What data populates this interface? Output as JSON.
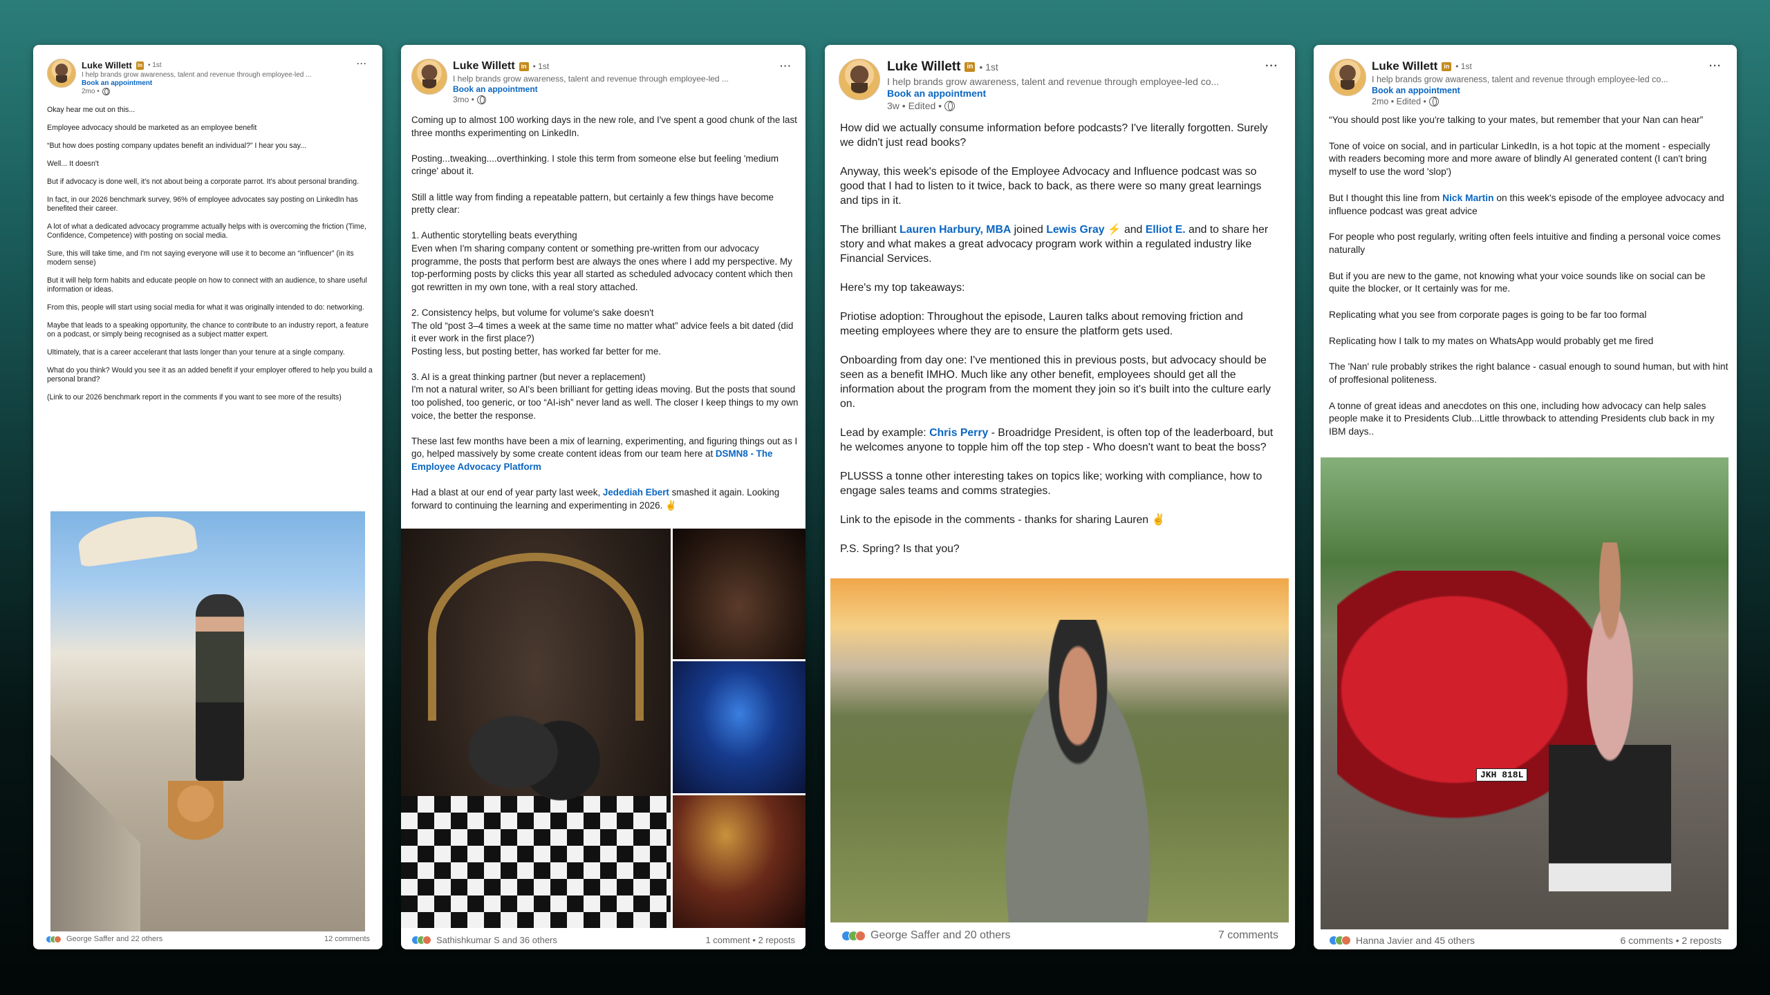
{
  "posts": [
    {
      "author": "Luke Willett",
      "badge": "in",
      "degree": "• 1st",
      "headline": "I help brands grow awareness, talent and revenue through employee-led ...",
      "cta": "Book an appointment",
      "meta": "2mo •",
      "body": [
        [
          {
            "t": "Okay hear me out on this..."
          }
        ],
        [
          {
            "t": "Employee advocacy should be marketed as an employee benefit"
          }
        ],
        [
          {
            "t": "“But how does posting company updates benefit an individual?” I hear you say..."
          }
        ],
        [
          {
            "t": "Well... It doesn't"
          }
        ],
        [
          {
            "t": "But if advocacy is done well, it's not about being a corporate parrot. It's about personal branding."
          }
        ],
        [
          {
            "t": "In fact, in our 2026 benchmark survey, 96% of employee advocates say posting on LinkedIn has benefited their career."
          }
        ],
        [
          {
            "t": "A lot of what a dedicated advocacy programme actually helps with is overcoming the friction (Time, Confidence, Competence) with posting on social media."
          }
        ],
        [
          {
            "t": "Sure, this will take time, and I'm not saying everyone will use it to become an “influencer” (in its modern sense)"
          }
        ],
        [
          {
            "t": "But it will help form habits and educate people on how to connect with an audience, to share useful information or ideas."
          }
        ],
        [
          {
            "t": "From this, people will start using social media for what it was originally intended to do: networking."
          }
        ],
        [
          {
            "t": "Maybe that leads to a speaking opportunity, the chance to contribute to an industry report, a feature on a podcast, or simply being recognised as a subject matter expert."
          }
        ],
        [
          {
            "t": "Ultimately, that is a career accelerant that lasts longer than your tenure at a single company."
          }
        ],
        [
          {
            "t": "What do you think? Would you see it as an added benefit if your employer offered to help you build a personal brand?"
          }
        ],
        [
          {
            "t": "(Link to our 2026 benchmark report in the comments if you want to see more of the results)"
          }
        ]
      ],
      "reactions": "George Saffer and 22 others",
      "stats": "12 comments"
    },
    {
      "author": "Luke Willett",
      "badge": "in",
      "degree": "• 1st",
      "headline": "I help brands grow awareness, talent and revenue through employee-led ...",
      "cta": "Book an appointment",
      "meta": "3mo •",
      "body": [
        [
          {
            "t": "Coming up to almost 100 working days in the new role, and I've spent a good chunk of the last three months experimenting on LinkedIn."
          }
        ],
        [
          {
            "t": "Posting...tweaking....overthinking. I stole this term from someone else but feeling 'medium cringe' about it."
          }
        ],
        [
          {
            "t": "Still a little way from finding a repeatable pattern, but certainly a few things have become pretty clear:"
          }
        ],
        [
          {
            "t": "1. Authentic storytelling beats everything\nEven when I'm sharing company content or something pre-written from our advocacy programme, the posts that perform best are always the ones where I add my perspective. My top-performing posts by clicks this year all started as scheduled advocacy content which then got rewritten in my own tone, with a real story attached."
          }
        ],
        [
          {
            "t": "2. Consistency helps, but volume for volume's sake doesn't\nThe old “post 3–4 times a week at the same time no matter what” advice feels a bit dated (did it ever work in the first place?)\nPosting less, but posting better, has worked far better for me."
          }
        ],
        [
          {
            "t": "3. AI is a great thinking partner (but never a replacement)\nI'm not a natural writer, so AI's been brilliant for getting ideas moving. But the posts that sound too polished, too generic, or too “AI-ish” never land as well. The closer I keep things to my own voice, the better the response."
          }
        ],
        [
          {
            "t": "These last few months have been a mix of learning, experimenting, and figuring things out as I go, helped massively by some create content ideas from our team here at "
          },
          {
            "t": "DSMN8 - The Employee Advocacy Platform",
            "m": 1
          }
        ],
        [
          {
            "t": "Had a blast at our end of year party last week, "
          },
          {
            "t": "Jedediah Ebert",
            "m": 1
          },
          {
            "t": " smashed it again. Looking forward to continuing the learning and experimenting in 2026. ✌️"
          }
        ]
      ],
      "reactions": "Sathishkumar S and 36 others",
      "stats": "1 comment • 2 reposts"
    },
    {
      "author": "Luke Willett",
      "badge": "in",
      "degree": "• 1st",
      "headline": "I help brands grow awareness, talent and revenue through employee-led co...",
      "cta": "Book an appointment",
      "meta": "3w • Edited •",
      "body": [
        [
          {
            "t": "How did we actually consume information before podcasts? I've literally forgotten. Surely we didn't just read books?"
          }
        ],
        [
          {
            "t": "Anyway, this week's episode of the Employee Advocacy and Influence podcast was so good that I had to listen to it twice, back to back, as there were so many great learnings and tips in it."
          }
        ],
        [
          {
            "t": "The brilliant "
          },
          {
            "t": "Lauren Harbury, MBA",
            "m": 1
          },
          {
            "t": " joined "
          },
          {
            "t": "Lewis Gray",
            "m": 1
          },
          {
            "t": " ⚡️ and "
          },
          {
            "t": "Elliot E.",
            "m": 1
          },
          {
            "t": " and to share her story and what makes a great advocacy program work within a regulated industry like Financial Services."
          }
        ],
        [
          {
            "t": "Here's my top takeaways:"
          }
        ],
        [
          {
            "t": "Priotise adoption: Throughout the episode, Lauren talks about removing friction and meeting employees where they are to ensure the platform gets used."
          }
        ],
        [
          {
            "t": "Onboarding from day one: I've mentioned this in previous posts, but advocacy should be seen as a benefit IMHO. Much like any other benefit, employees should get all the information about the program from the moment they join so it's built into the culture early on."
          }
        ],
        [
          {
            "t": "Lead by example: "
          },
          {
            "t": "Chris Perry",
            "m": 1
          },
          {
            "t": " - Broadridge President, is often top of the leaderboard, but he welcomes anyone to topple him off the top step - Who doesn't want to beat the boss?"
          }
        ],
        [
          {
            "t": "PLUSSS a tonne other interesting takes on topics like; working with compliance, how to engage sales teams and comms strategies."
          }
        ],
        [
          {
            "t": "Link to the episode in the comments - thanks for sharing Lauren ✌️"
          }
        ],
        [
          {
            "t": "P.S. Spring? Is that you?"
          }
        ]
      ],
      "reactions": "George Saffer and 20 others",
      "stats": "7 comments"
    },
    {
      "author": "Luke Willett",
      "badge": "in",
      "degree": "• 1st",
      "headline": "I help brands grow awareness, talent and revenue through employee-led co...",
      "cta": "Book an appointment",
      "meta": "2mo • Edited •",
      "body": [
        [
          {
            "t": "“You should post like you're talking to your mates, but remember that your Nan can hear”"
          }
        ],
        [
          {
            "t": "Tone of voice on social, and in particular LinkedIn, is a hot topic at the moment - especially with readers becoming more and more aware of blindly AI generated content (I can't bring myself to use the word 'slop')"
          }
        ],
        [
          {
            "t": "But I thought this line from "
          },
          {
            "t": "Nick Martin",
            "m": 1
          },
          {
            "t": " on this week's episode of the employee advocacy and influence podcast was great advice"
          }
        ],
        [
          {
            "t": "For people who post regularly, writing often feels intuitive and finding a personal voice comes naturally"
          }
        ],
        [
          {
            "t": "But if you are new to the game, not knowing what your voice sounds like on social can be quite the blocker, or It certainly was for me."
          }
        ],
        [
          {
            "t": "Replicating what you see from corporate pages is going to be far too formal"
          }
        ],
        [
          {
            "t": "Replicating how I talk to my mates on WhatsApp would probably get me fired"
          }
        ],
        [
          {
            "t": "The 'Nan' rule probably strikes the right balance - casual enough to sound human, but with hint of proffesional politeness."
          }
        ],
        [
          {
            "t": "A tonne of great ideas and anecdotes on this one, including how advocacy can help sales people make it to Presidents Club...Little throwback to attending Presidents club back in my IBM days.."
          }
        ]
      ],
      "reactions": "Hanna Javier and 45 others",
      "stats": "6 comments • 2 reposts"
    }
  ],
  "car_plate": "JKH 818L",
  "colors": {
    "link": "#0a66c2",
    "badge": "#c48a1c",
    "muted": "#666666"
  },
  "icons": [
    "avatar",
    "linkedin-premium-badge-icon",
    "globe-icon",
    "more-options-icon",
    "reaction-icons"
  ]
}
